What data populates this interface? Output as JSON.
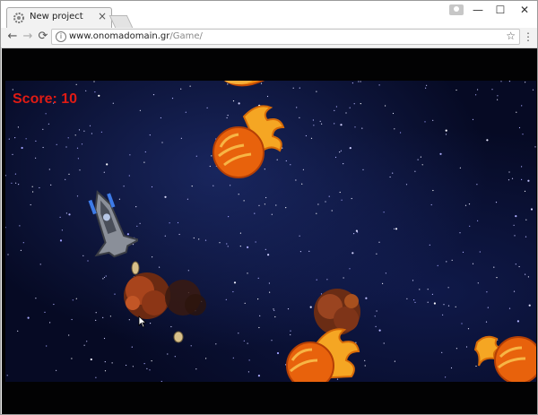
{
  "browser": {
    "tab_title": "New project",
    "tab_close": "×",
    "url_host": "www.onomadomain.gr",
    "url_path": "/Game/",
    "back": "←",
    "forward": "→",
    "reload": "⟳",
    "minimize": "—",
    "maximize": "☐",
    "close": "✕",
    "star": "☆",
    "menu": "⋮",
    "info": "i"
  },
  "game": {
    "score_text": "Score: 10"
  },
  "icons": {
    "favicon": "gear-icon",
    "player": "spaceship",
    "meteor": "fireball",
    "explosion": "explosion",
    "missile": "missile"
  },
  "colors": {
    "score": "#e01b14",
    "space": "#060a24"
  }
}
